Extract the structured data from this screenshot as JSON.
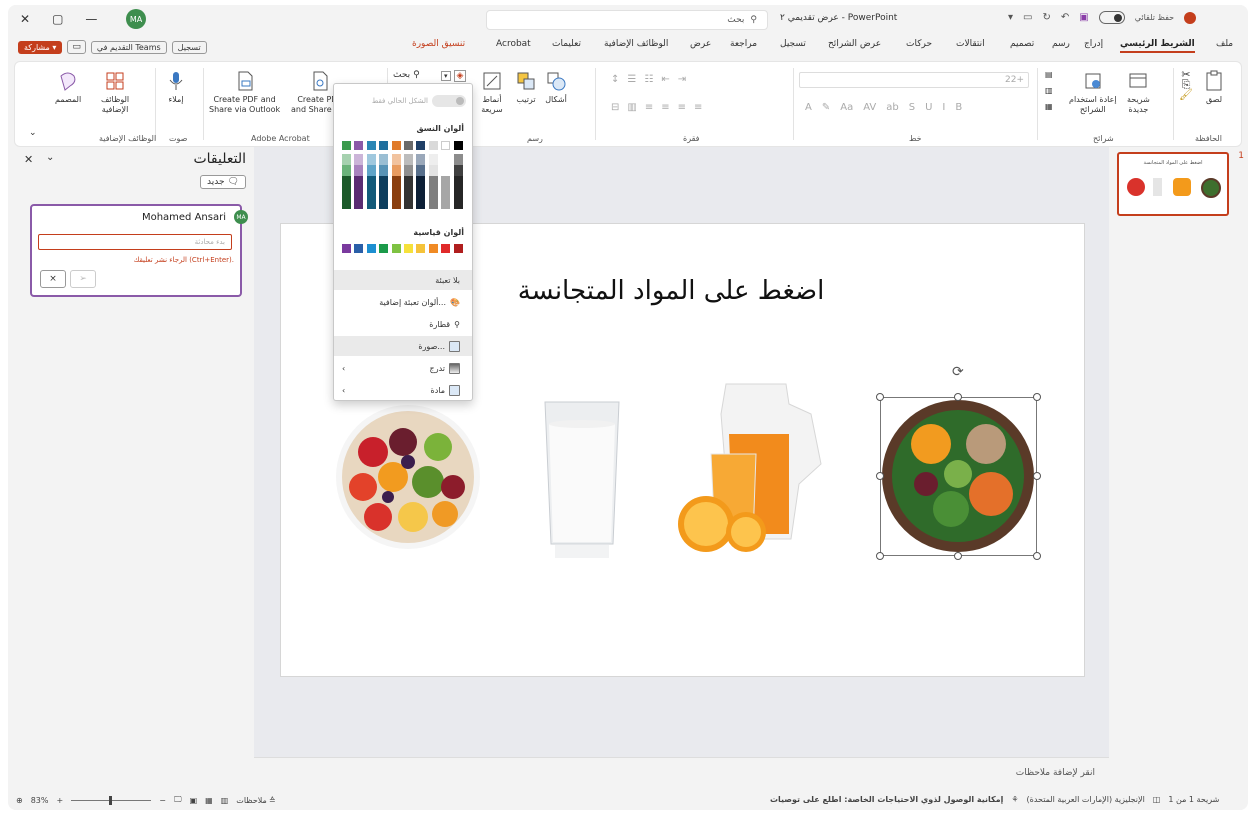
{
  "app": {
    "title": "عرض تقديمي ٢ - PowerPoint",
    "search_placeholder": "بحث",
    "autosave_label": "حفظ تلقائي",
    "user_initials": "MA"
  },
  "ribbon_tabs": {
    "file": "ملف",
    "home": "الشريط الرئيسي",
    "insert": "إدراج",
    "draw": "رسم",
    "design": "تصميم",
    "transitions": "انتقالات",
    "animations": "حركات",
    "slideshow": "عرض الشرائح",
    "record": "تسجيل",
    "review": "مراجعة",
    "view": "عرض",
    "addins": "الوظائف الإضافية",
    "help": "تعليمات",
    "acrobat": "Acrobat",
    "picture_format": "تنسيق الصورة"
  },
  "actions": {
    "record": "تسجيل",
    "present_teams": "التقديم في Teams",
    "share": "مشاركة"
  },
  "ribbon": {
    "paste": "لصق",
    "clipboard": "الحافظة",
    "new_slide_1": "شريحة",
    "new_slide_2": "جديدة",
    "reuse_1": "إعادة استخدام",
    "reuse_2": "الشرائح",
    "slides": "شرائح",
    "font": "خط",
    "font_size": "22+",
    "paragraph": "فقرة",
    "shapes": "أشكال",
    "arrange": "ترتيب",
    "quick_styles_1": "أنماط",
    "quick_styles_2": "سريعة",
    "drawing": "رسم",
    "ribbon_search": "بحث",
    "acrobat_btn1_l1": "Create PDF and",
    "acrobat_btn1_l2": "Share via Outlook",
    "acrobat_btn2_l1": "Create PDF",
    "acrobat_btn2_l2": "and Share link",
    "adobe_acrobat": "Adobe Acrobat",
    "dictate": "إملاء",
    "voice": "صوت",
    "addins_1": "الوظائف",
    "addins_2": "الإضافية",
    "addins_group": "الوظائف الإضافية",
    "designer": "المصمم"
  },
  "color_menu": {
    "cur_slide_only": "الشكل الحالي فقط",
    "theme_colors": "ألوان النسق",
    "standard_colors": "ألوان قياسية",
    "no_fill": "بلا تعبئة",
    "more_fill": "ألوان تعبئة إضافية...",
    "eyedropper": "قطارة",
    "picture": "صورة...",
    "gradient": "تدرج",
    "texture": "مادة"
  },
  "comments": {
    "title": "التعليقات",
    "new_btn": "جديد",
    "author": "Mohamed Ansari",
    "author_initials": "MA",
    "input_placeholder": "بدء محادثة",
    "hint": "الرجاء نشر تعليقك (Ctrl+Enter).",
    "cancel": "×",
    "post": "➢"
  },
  "slide": {
    "title": "اضغط على المواد المتجانسة",
    "thumb_number": "1",
    "thumb_title": "اضغط على المواد المتجانسة"
  },
  "notes": {
    "placeholder": "انقر لإضافة ملاحظات"
  },
  "status": {
    "slide_count": "شريحة 1 من 1",
    "language": "الإنجليزية (الإمارات العربية المتحدة)",
    "accessibility": "إمكانية الوصول لذوي الاحتياجات الخاصة: اطلع على توصيات",
    "notes": "ملاحظات",
    "zoom": "83%"
  },
  "colors": {
    "accent": "#c43e1c",
    "comment_border": "#8a5aa8",
    "avatar": "#3e8e4e"
  }
}
